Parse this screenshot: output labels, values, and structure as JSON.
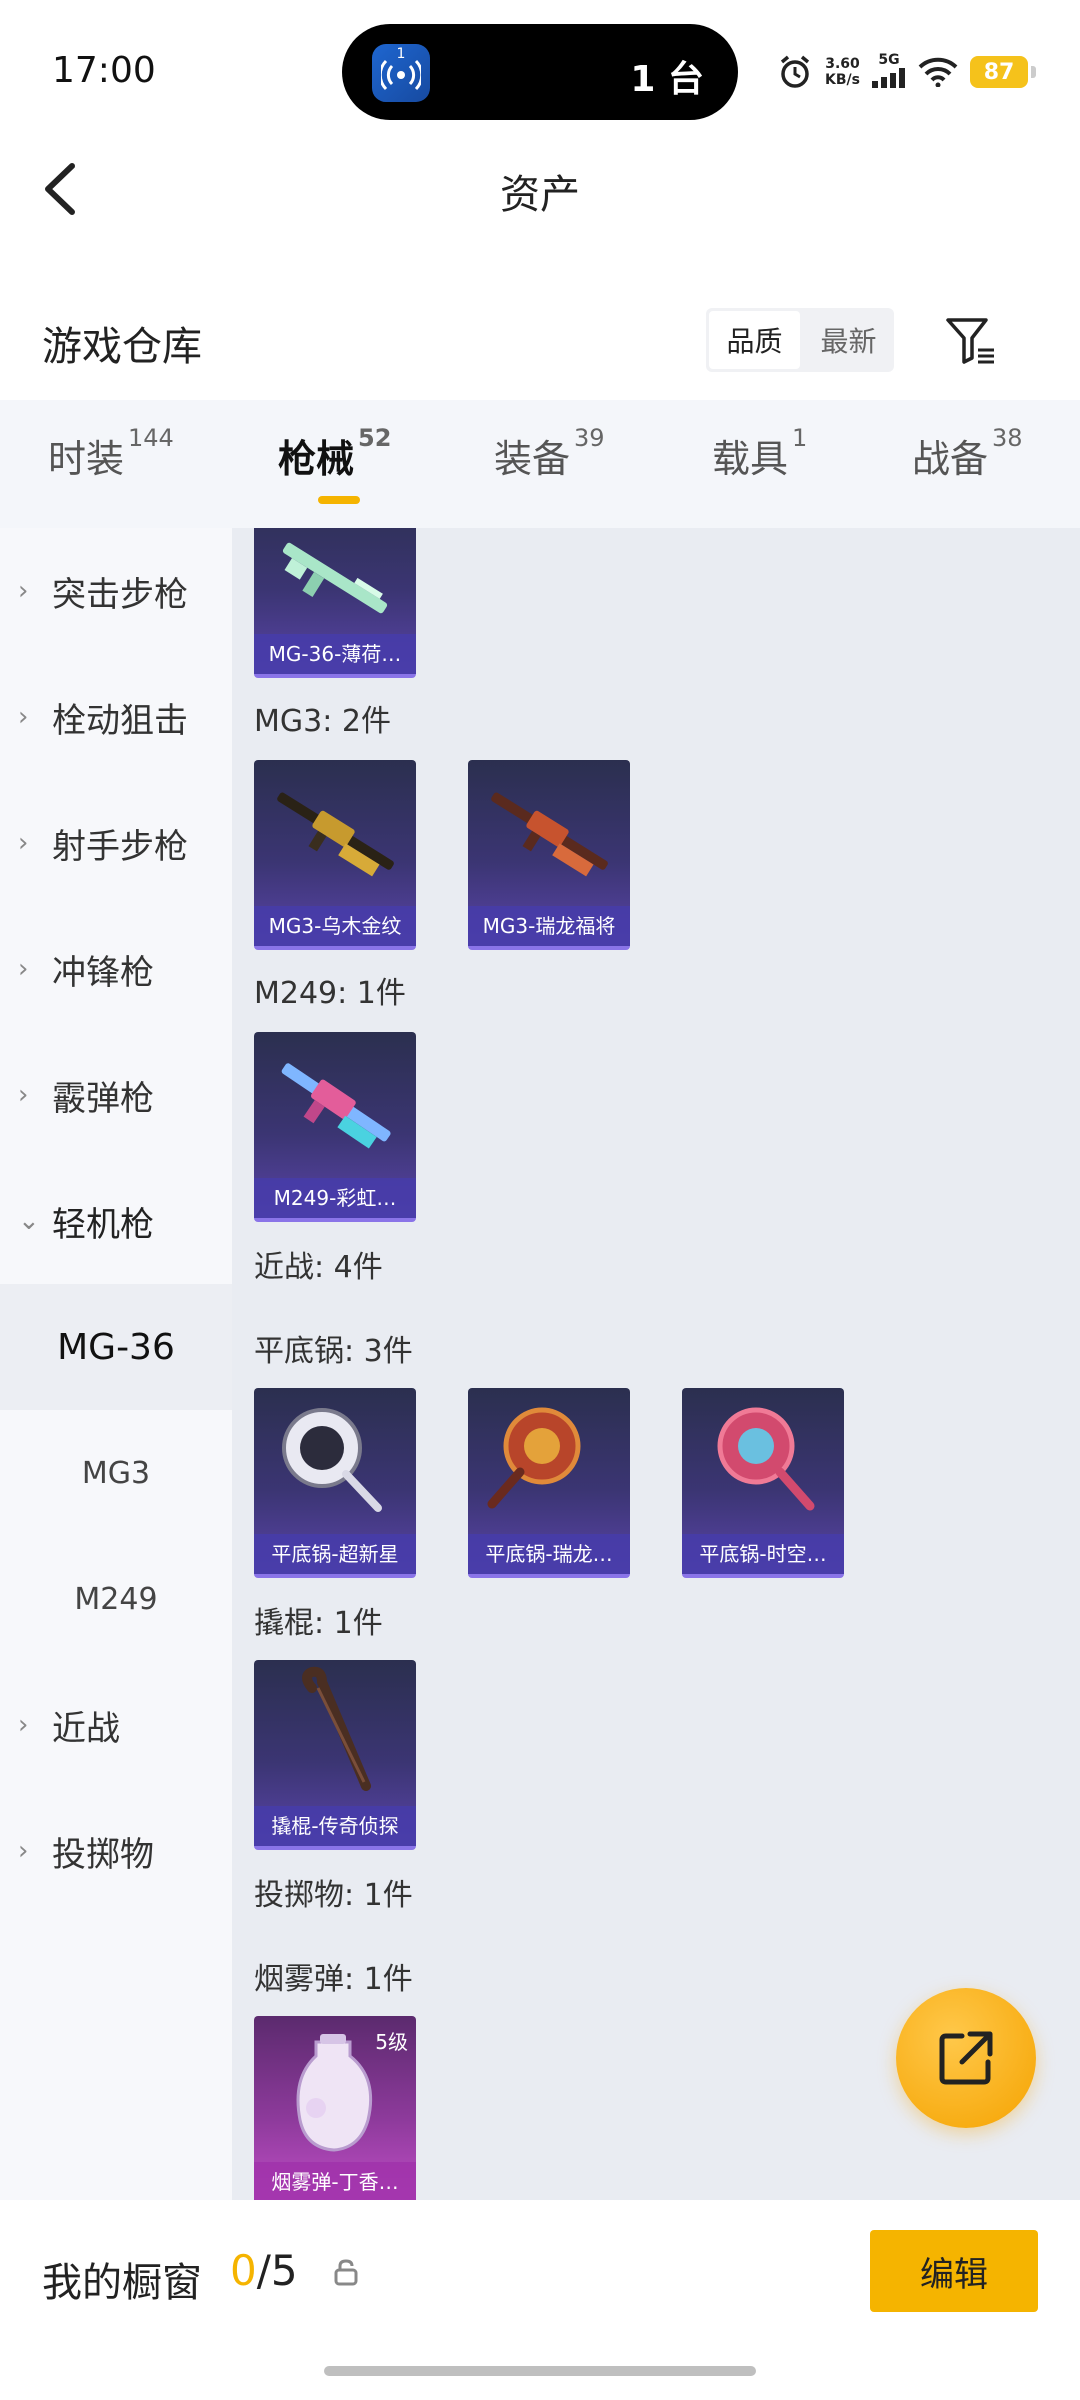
{
  "status_bar": {
    "time": "17:00",
    "island_badge": "1",
    "island_count": "1 台",
    "net_speed_value": "3.60",
    "net_speed_unit": "KB/s",
    "network": "5G",
    "battery": "87"
  },
  "nav": {
    "title": "资产"
  },
  "section": {
    "title": "游戏仓库",
    "sort_options": [
      "品质",
      "最新"
    ],
    "sort_selected": "品质"
  },
  "tabs": [
    {
      "label": "时装",
      "count": "144"
    },
    {
      "label": "枪械",
      "count": "52",
      "active": true
    },
    {
      "label": "装备",
      "count": "39"
    },
    {
      "label": "载具",
      "count": "1"
    },
    {
      "label": "战备",
      "count": "38"
    }
  ],
  "sidebar": {
    "items": [
      {
        "label": "突击步枪"
      },
      {
        "label": "栓动狙击"
      },
      {
        "label": "射手步枪"
      },
      {
        "label": "冲锋枪"
      },
      {
        "label": "霰弹枪"
      },
      {
        "label": "轻机枪"
      },
      {
        "label": "MG-36"
      },
      {
        "label": "MG3"
      },
      {
        "label": "M249"
      },
      {
        "label": "近战"
      },
      {
        "label": "投掷物"
      }
    ]
  },
  "content": {
    "groups": [
      {
        "label": "MG3: 2件"
      },
      {
        "label": "M249: 1件"
      },
      {
        "label": "近战: 4件"
      },
      {
        "label": "平底锅: 3件"
      },
      {
        "label": "撬棍: 1件"
      },
      {
        "label": "投掷物: 1件"
      },
      {
        "label": "烟雾弹: 1件"
      }
    ],
    "items": [
      {
        "name": "MG-36-薄荷…",
        "icon": "mg36-rifle-icon"
      },
      {
        "name": "MG3-乌木金纹",
        "icon": "mg3-gun-icon"
      },
      {
        "name": "MG3-瑞龙福将",
        "icon": "mg3-gun-icon"
      },
      {
        "name": "M249-彩虹…",
        "icon": "m249-gun-icon"
      },
      {
        "name": "平底锅-超新星",
        "icon": "frying-pan-icon"
      },
      {
        "name": "平底锅-瑞龙…",
        "icon": "frying-pan-icon"
      },
      {
        "name": "平底锅-时空…",
        "icon": "frying-pan-icon"
      },
      {
        "name": "撬棍-传奇侦探",
        "icon": "crowbar-icon"
      },
      {
        "name": "烟雾弹-丁香…",
        "icon": "smoke-grenade-icon",
        "level": "5级"
      }
    ]
  },
  "bottom": {
    "showcase_label": "我的橱窗",
    "showcase_current": "0",
    "showcase_total": "/5",
    "edit_label": "编辑"
  },
  "colors": {
    "accent": "#f5b400",
    "card_purple": "#5a44a8",
    "card_pink": "#c04ec6"
  }
}
